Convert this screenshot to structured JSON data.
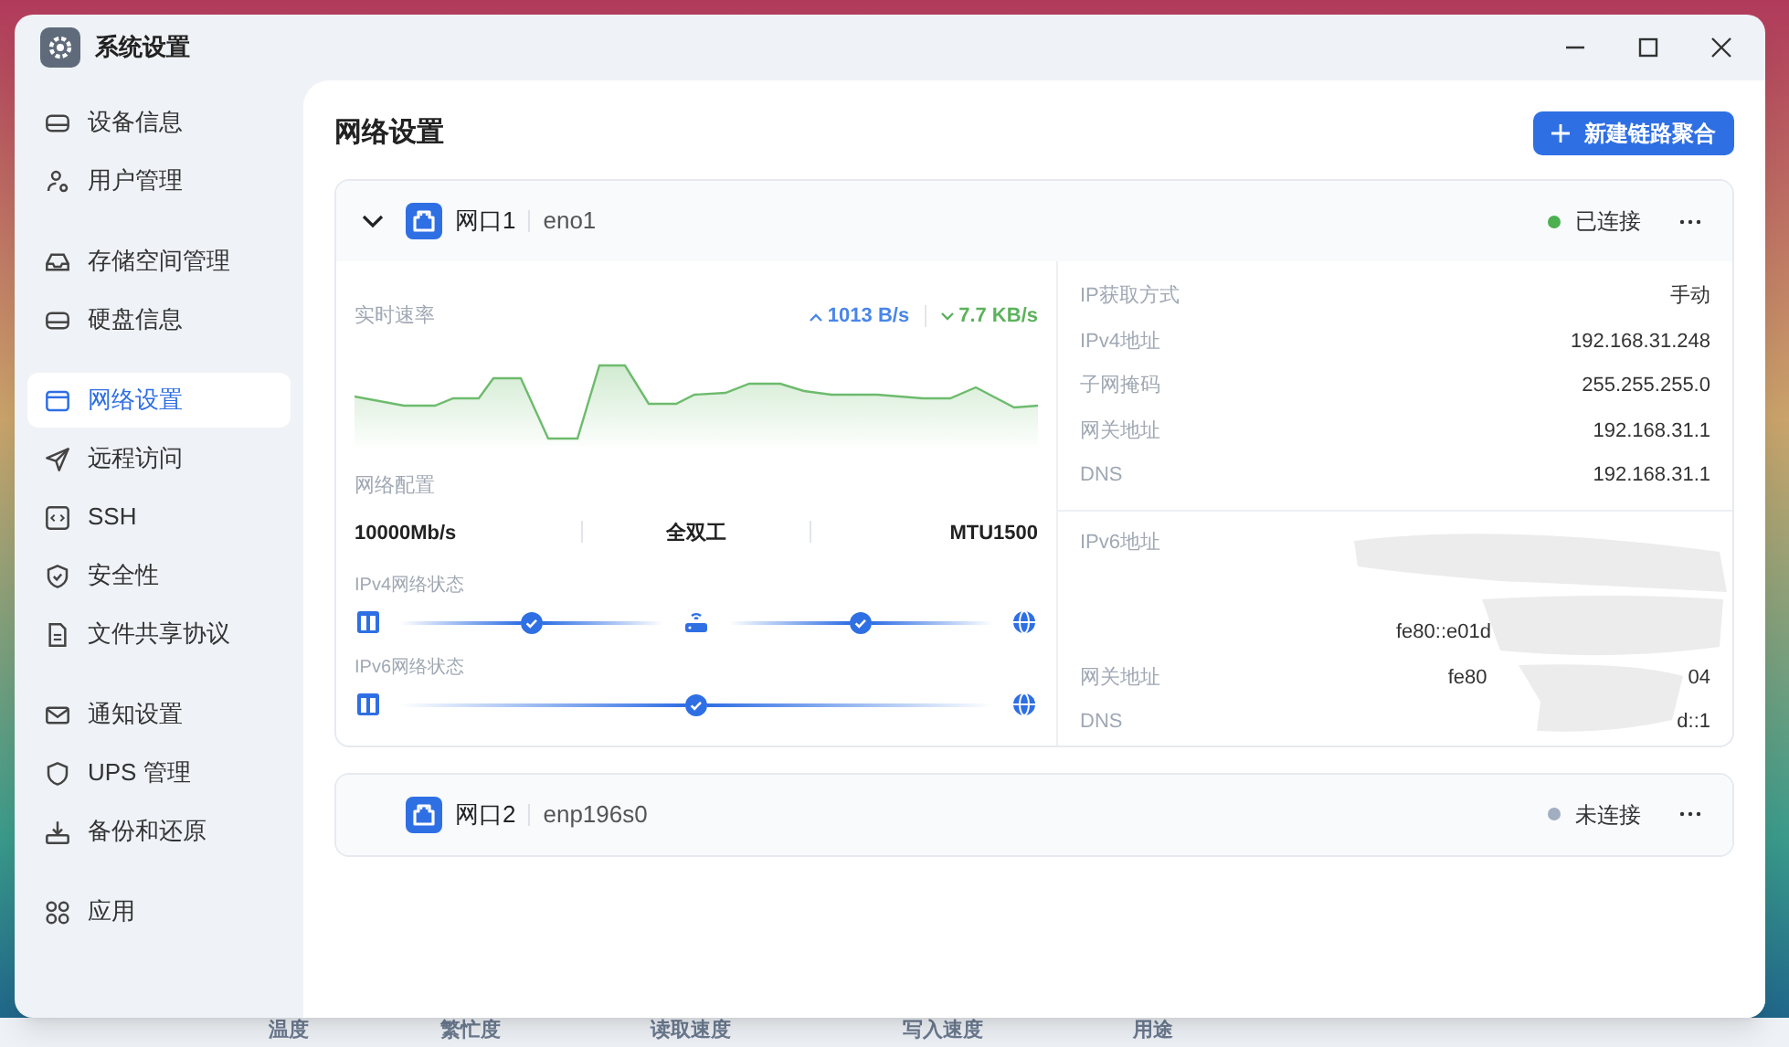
{
  "window": {
    "title": "系统设置"
  },
  "sidebar": {
    "groups": [
      [
        {
          "label": "设备信息",
          "selected": false
        },
        {
          "label": "用户管理",
          "selected": false
        }
      ],
      [
        {
          "label": "存储空间管理",
          "selected": false
        },
        {
          "label": "硬盘信息",
          "selected": false
        }
      ],
      [
        {
          "label": "网络设置",
          "selected": true
        },
        {
          "label": "远程访问",
          "selected": false
        },
        {
          "label": "SSH",
          "selected": false
        },
        {
          "label": "安全性",
          "selected": false
        },
        {
          "label": "文件共享协议",
          "selected": false
        }
      ],
      [
        {
          "label": "通知设置",
          "selected": false
        },
        {
          "label": "UPS 管理",
          "selected": false
        },
        {
          "label": "备份和还原",
          "selected": false
        }
      ],
      [
        {
          "label": "应用",
          "selected": false
        }
      ]
    ]
  },
  "content": {
    "title": "网络设置",
    "new_button": "新建链路聚合",
    "ports": [
      {
        "name": "网口1",
        "device": "eno1",
        "expanded": true,
        "status": "已连接",
        "color": "#4caf50",
        "speed": {
          "label": "实时速率",
          "up": "1013 B/s",
          "down": "7.7 KB/s"
        },
        "config": {
          "label": "网络配置",
          "values": [
            "10000Mb/s",
            "全双工",
            "MTU1500"
          ]
        },
        "paths": [
          {
            "label": "IPv4网络状态",
            "nodes": [
              {
                "kind": "nic"
              },
              {
                "kind": "ok"
              },
              {
                "kind": "router"
              },
              {
                "kind": "ok"
              },
              {
                "kind": "globe"
              }
            ]
          },
          {
            "label": "IPv6网络状态",
            "nodes": [
              {
                "kind": "nic"
              },
              {
                "kind": "ok"
              },
              {
                "kind": "globe"
              }
            ]
          }
        ],
        "ipv4_info": [
          {
            "label": "IP获取方式",
            "value": "手动"
          },
          {
            "label": "IPv4地址",
            "value": "192.168.31.248"
          },
          {
            "label": "子网掩码",
            "value": "255.255.255.0"
          },
          {
            "label": "网关地址",
            "value": "192.168.31.1"
          },
          {
            "label": "DNS",
            "value": "192.168.31.1"
          }
        ],
        "ipv6_info": [
          {
            "label": "IPv6地址"
          },
          {
            "value": "fe80::e01d"
          },
          {
            "label": "网关地址",
            "value": "fe80",
            "value_end": "04"
          },
          {
            "label": "DNS",
            "value_end": "d::1"
          }
        ]
      },
      {
        "name": "网口2",
        "device": "enp196s0",
        "expanded": false,
        "status": "未连接",
        "color": "#a0aec0"
      }
    ]
  },
  "background_window": {
    "columns": [
      "温度",
      "繁忙度",
      "读取速度",
      "写入速度",
      "用途"
    ]
  }
}
